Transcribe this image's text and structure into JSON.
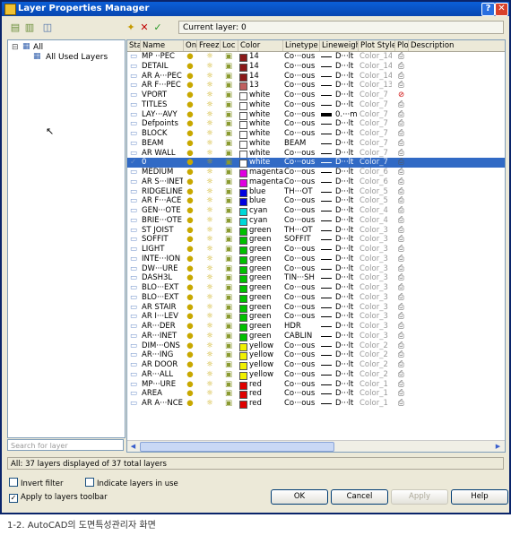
{
  "window": {
    "title": "Layer Properties Manager",
    "help_glyph": "?",
    "close_glyph": "✕"
  },
  "toolbar": {
    "current_layer_label": "Current layer: 0"
  },
  "tree": {
    "root": "All",
    "child": "All Used Layers",
    "expander": "⊟"
  },
  "search": {
    "placeholder": "Search for layer"
  },
  "columns": [
    "Sta",
    "Name",
    "On",
    "Freez",
    "Loc",
    "Color",
    "Linetype",
    "Lineweight",
    "Plot Style",
    "Plo",
    "Description"
  ],
  "layers": [
    {
      "name": "MP ··PEC",
      "color_name": "14",
      "color": "#8b1a1a",
      "linetype": "Co···ous",
      "lineweight": "D···lt",
      "plot_style": "Color_14"
    },
    {
      "name": "DETAIL",
      "color_name": "14",
      "color": "#8b1a1a",
      "linetype": "Co···ous",
      "lineweight": "D···lt",
      "plot_style": "Color_14"
    },
    {
      "name": "AR A···PEC",
      "color_name": "14",
      "color": "#8b1a1a",
      "linetype": "Co···ous",
      "lineweight": "D···lt",
      "plot_style": "Color_14"
    },
    {
      "name": "AR F···PEC",
      "color_name": "13",
      "color": "#c06060",
      "linetype": "Co···ous",
      "lineweight": "D···lt",
      "plot_style": "Color_13"
    },
    {
      "name": "VPORT",
      "color_name": "white",
      "color": "#ffffff",
      "linetype": "Co···ous",
      "lineweight": "D···lt",
      "plot_style": "Color_7",
      "noplot": true
    },
    {
      "name": "TITLES",
      "color_name": "white",
      "color": "#ffffff",
      "linetype": "Co···ous",
      "lineweight": "D···lt",
      "plot_style": "Color_7"
    },
    {
      "name": "LAY···AVY",
      "color_name": "white",
      "color": "#ffffff",
      "linetype": "Co···ous",
      "lineweight": "0.···m",
      "plot_style": "Color_7",
      "thick": true
    },
    {
      "name": "Defpoints",
      "color_name": "white",
      "color": "#ffffff",
      "linetype": "Co···ous",
      "lineweight": "D···lt",
      "plot_style": "Color_7"
    },
    {
      "name": "BLOCK",
      "color_name": "white",
      "color": "#ffffff",
      "linetype": "Co···ous",
      "lineweight": "D···lt",
      "plot_style": "Color_7"
    },
    {
      "name": "BEAM",
      "color_name": "white",
      "color": "#ffffff",
      "linetype": "BEAM",
      "lineweight": "D···lt",
      "plot_style": "Color_7"
    },
    {
      "name": "AR WALL",
      "color_name": "white",
      "color": "#ffffff",
      "linetype": "Co···ous",
      "lineweight": "D···lt",
      "plot_style": "Color_7"
    },
    {
      "name": "0",
      "color_name": "white",
      "color": "#ffffff",
      "linetype": "Co···ous",
      "lineweight": "D···lt",
      "plot_style": "Color_7",
      "selected": true
    },
    {
      "name": "MEDIUM",
      "color_name": "magenta",
      "color": "#e000e0",
      "linetype": "Co···ous",
      "lineweight": "D···lt",
      "plot_style": "Color_6"
    },
    {
      "name": "AR S···INET",
      "color_name": "magenta",
      "color": "#e000e0",
      "linetype": "Co···ous",
      "lineweight": "D···lt",
      "plot_style": "Color_6"
    },
    {
      "name": "RIDGELINE",
      "color_name": "blue",
      "color": "#0000e0",
      "linetype": "TH···OT",
      "lineweight": "D···lt",
      "plot_style": "Color_5"
    },
    {
      "name": "AR F···ACE",
      "color_name": "blue",
      "color": "#0000e0",
      "linetype": "Co···ous",
      "lineweight": "D···lt",
      "plot_style": "Color_5"
    },
    {
      "name": "GEN···OTE",
      "color_name": "cyan",
      "color": "#00d8d8",
      "linetype": "Co···ous",
      "lineweight": "D···lt",
      "plot_style": "Color_4"
    },
    {
      "name": "BRIE···OTE",
      "color_name": "cyan",
      "color": "#00d8d8",
      "linetype": "Co···ous",
      "lineweight": "D···lt",
      "plot_style": "Color_4"
    },
    {
      "name": "ST JOIST",
      "color_name": "green",
      "color": "#00c000",
      "linetype": "TH···OT",
      "lineweight": "D···lt",
      "plot_style": "Color_3"
    },
    {
      "name": "SOFFIT",
      "color_name": "green",
      "color": "#00c000",
      "linetype": "SOFFIT",
      "lineweight": "D···lt",
      "plot_style": "Color_3"
    },
    {
      "name": "LIGHT",
      "color_name": "green",
      "color": "#00c000",
      "linetype": "Co···ous",
      "lineweight": "D···lt",
      "plot_style": "Color_3"
    },
    {
      "name": "INTE···ION",
      "color_name": "green",
      "color": "#00c000",
      "linetype": "Co···ous",
      "lineweight": "D···lt",
      "plot_style": "Color_3"
    },
    {
      "name": "DW···URE",
      "color_name": "green",
      "color": "#00c000",
      "linetype": "Co···ous",
      "lineweight": "D···lt",
      "plot_style": "Color_3"
    },
    {
      "name": "DASH3L",
      "color_name": "green",
      "color": "#00c000",
      "linetype": "TIN···SH",
      "lineweight": "D···lt",
      "plot_style": "Color_3"
    },
    {
      "name": "BLO···EXT",
      "color_name": "green",
      "color": "#00c000",
      "linetype": "Co···ous",
      "lineweight": "D···lt",
      "plot_style": "Color_3"
    },
    {
      "name": "BLO···EXT",
      "color_name": "green",
      "color": "#00c000",
      "linetype": "Co···ous",
      "lineweight": "D···lt",
      "plot_style": "Color_3"
    },
    {
      "name": "AR STAIR",
      "color_name": "green",
      "color": "#00c000",
      "linetype": "Co···ous",
      "lineweight": "D···lt",
      "plot_style": "Color_3"
    },
    {
      "name": "AR I···LEV",
      "color_name": "green",
      "color": "#00c000",
      "linetype": "Co···ous",
      "lineweight": "D···lt",
      "plot_style": "Color_3"
    },
    {
      "name": "AR···DER",
      "color_name": "green",
      "color": "#00c000",
      "linetype": "HDR",
      "lineweight": "D···lt",
      "plot_style": "Color_3"
    },
    {
      "name": "AR···INET",
      "color_name": "green",
      "color": "#00c000",
      "linetype": "CABLIN",
      "lineweight": "D···lt",
      "plot_style": "Color_3"
    },
    {
      "name": "DIM···ONS",
      "color_name": "yellow",
      "color": "#f0f000",
      "linetype": "Co···ous",
      "lineweight": "D···lt",
      "plot_style": "Color_2"
    },
    {
      "name": "AR···ING",
      "color_name": "yellow",
      "color": "#f0f000",
      "linetype": "Co···ous",
      "lineweight": "D···lt",
      "plot_style": "Color_2"
    },
    {
      "name": "AR DOOR",
      "color_name": "yellow",
      "color": "#f0f000",
      "linetype": "Co···ous",
      "lineweight": "D···lt",
      "plot_style": "Color_2"
    },
    {
      "name": "AR···ALL",
      "color_name": "yellow",
      "color": "#f0f000",
      "linetype": "Co···ous",
      "lineweight": "D···lt",
      "plot_style": "Color_2"
    },
    {
      "name": "MP···URE",
      "color_name": "red",
      "color": "#e00000",
      "linetype": "Co···ous",
      "lineweight": "D···lt",
      "plot_style": "Color_1"
    },
    {
      "name": "AREA",
      "color_name": "red",
      "color": "#e00000",
      "linetype": "Co···ous",
      "lineweight": "D···lt",
      "plot_style": "Color_1"
    },
    {
      "name": "AR A···NCE",
      "color_name": "red",
      "color": "#e00000",
      "linetype": "Co···ous",
      "lineweight": "D···lt",
      "plot_style": "Color_1"
    }
  ],
  "status_text": "All: 37 layers displayed of 37 total layers",
  "options": {
    "invert_filter": "Invert filter",
    "indicate_layers": "Indicate layers in use",
    "apply_toolbar": "Apply to layers toolbar"
  },
  "buttons": {
    "ok": "OK",
    "cancel": "Cancel",
    "apply": "Apply",
    "help": "Help"
  },
  "caption": "1-2. AutoCAD의 도면특성관리자 화면"
}
